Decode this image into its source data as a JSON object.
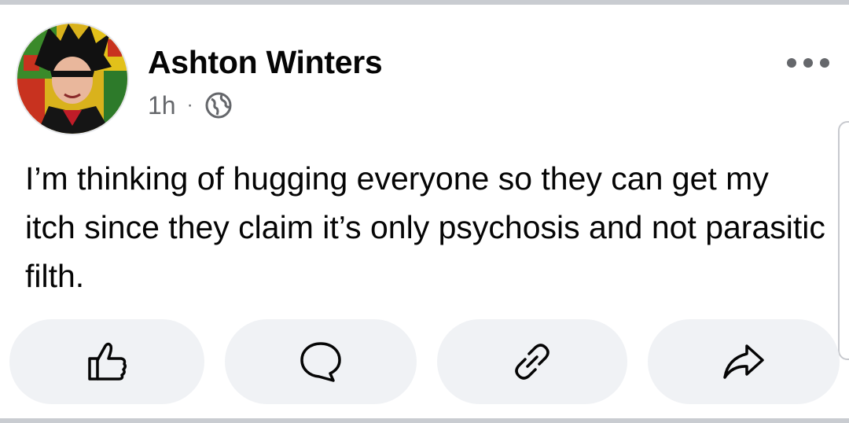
{
  "post": {
    "author": "Ashton Winters",
    "time": "1h",
    "separator": "·",
    "privacy_icon": "globe-icon",
    "more_icon": "more-dots-icon",
    "text": "I’m thinking of hugging everyone so they can get my itch since they claim it’s only psychosis and not parasitic filth."
  },
  "actions": [
    {
      "name": "like",
      "icon": "thumbs-up-icon"
    },
    {
      "name": "comment",
      "icon": "comment-bubble-icon"
    },
    {
      "name": "copy-link",
      "icon": "link-icon"
    },
    {
      "name": "share",
      "icon": "share-arrow-icon"
    }
  ],
  "colors": {
    "text_primary": "#050505",
    "text_secondary": "#65676b",
    "button_background": "#f0f2f5",
    "divider": "#c9ccd1"
  }
}
